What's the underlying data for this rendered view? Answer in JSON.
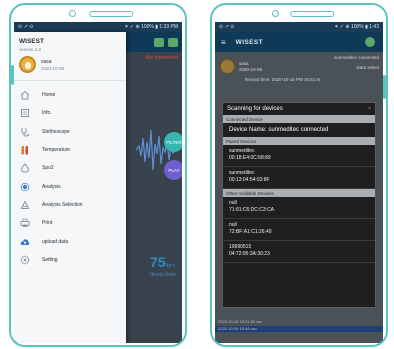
{
  "phone1": {
    "status": {
      "left": "⊙ ↗ ⊙",
      "right": "✶ ✓ ⊕ 100% ▮ 1:33 PM"
    },
    "app_status": "Not connected",
    "drawer": {
      "app_title": "WISEST",
      "version": "version 4.2",
      "user_name": "sasa",
      "user_date": "2020-10-08",
      "items": [
        {
          "label": "Home",
          "icon": "home-icon"
        },
        {
          "label": "Info.",
          "icon": "info-icon"
        },
        {
          "label": "Stethoscope",
          "icon": "stethoscope-icon"
        },
        {
          "label": "Temperature",
          "icon": "thermometer-icon"
        },
        {
          "label": "Spo2",
          "icon": "oxygen-drop-icon"
        },
        {
          "label": "Analysis",
          "icon": "analysis-icon"
        },
        {
          "label": "Analysis Selection",
          "icon": "analysis-selection-icon"
        },
        {
          "label": "Print",
          "icon": "printer-icon"
        },
        {
          "label": "upload data",
          "icon": "cloud-upload-icon"
        },
        {
          "label": "Setting",
          "icon": "gear-icon"
        }
      ]
    },
    "filter_btn": "FILTER",
    "play_btn": "PLAY",
    "heart_rate": {
      "value": "75",
      "unit": "bpm",
      "label": "Hearts Rate"
    },
    "colors": {
      "frame": "#5cc4c0",
      "toolbar": "#0e3a57",
      "status_bar": "#1a3c56"
    }
  },
  "phone2": {
    "status": {
      "left": "⊙ ↗ ⊙",
      "right": "✶ ✓ ⊕ 100% ▮ 1:43"
    },
    "app_title": "WISEST",
    "connection_status": "sunmeditec connected",
    "user_name": "sasa",
    "user_date": "2020-10-08",
    "data_select": "Data select",
    "record_time": "Record time: 2020-10-15 PM 16:51:m",
    "dialog": {
      "title": "Scanning for devices",
      "close": "×",
      "connected_header": "Connected Device",
      "connected_device": "Device Name: sunmeditec connected",
      "paired_header": "Paired Devices",
      "paired": [
        {
          "name": "sunmeditec",
          "mac": "00:18:E4:0C:68:89"
        },
        {
          "name": "sunmeditec",
          "mac": "00:13:04:54:03:8F"
        }
      ],
      "other_header": "Other Available Devices",
      "other": [
        {
          "name": "null",
          "mac": "71:91:C6:DC:C3:CA"
        },
        {
          "name": "null",
          "mac": "72:BF:A1:C1:26:40"
        },
        {
          "name": "19990515",
          "mac": "04:72:95:3A:30:23"
        }
      ]
    },
    "bottom_lines": [
      "2020-10-15 15:51:52.csv",
      "2020-10-09 15:46.csv"
    ]
  }
}
